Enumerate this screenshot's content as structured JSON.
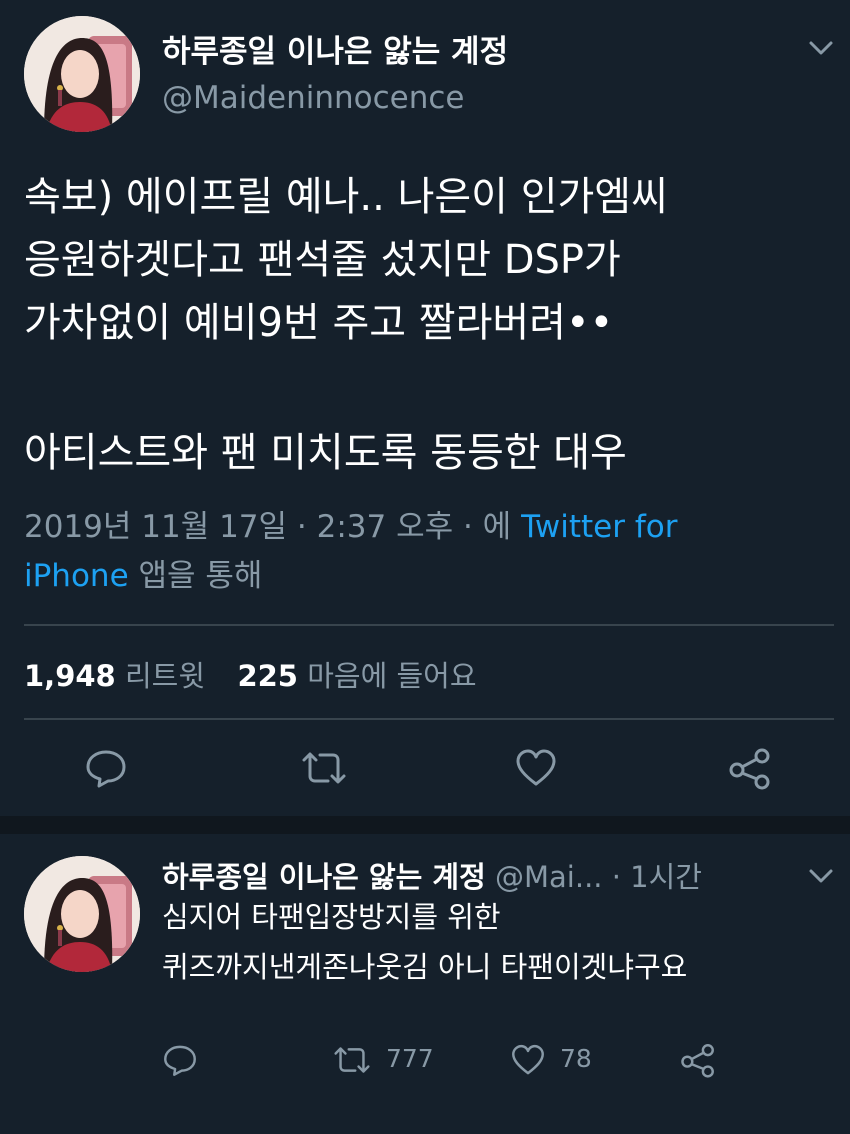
{
  "tweet": {
    "display_name": "하루종일 이나은 앓는 계정",
    "handle": "@Maideninnocence",
    "text_lines": [
      "속보) 에이프릴 예나.. 나은이 인가엠씨",
      "응원하겟다고 팬석줄 섰지만 DSP가",
      "가차없이 예비9번 주고 짤라버려••",
      "아티스트와 팬 미치도록 동등한 대우"
    ],
    "timestamp": "2019년 11월 17일 · 2:37 오후 · 에 ",
    "source_link_part1": "Twitter for",
    "source_link_part2": "iPhone",
    "source_suffix": " 앱을 통해",
    "retweet_count": "1,948",
    "retweet_label": " 리트윗",
    "like_count": "225",
    "like_label": " 마음에 들어요",
    "menu_icon": "chevron-down-icon",
    "actions": [
      "reply-icon",
      "retweet-icon",
      "like-icon",
      "share-icon"
    ]
  },
  "reply": {
    "display_name": "하루종일 이나은 앓는 계정",
    "handle": "@Mai...",
    "time": " · 1시간",
    "text_lines": [
      "심지어 타팬입장방지를 위한",
      "퀴즈까지낸게존나웃김 아니 타팬이겟냐구요"
    ],
    "retweet_count": "777",
    "like_count": "78"
  },
  "colors": {
    "background": "#15202b",
    "text": "#ffffff",
    "secondary": "#8899a6",
    "link": "#1da1f2",
    "divider": "#38444d"
  }
}
